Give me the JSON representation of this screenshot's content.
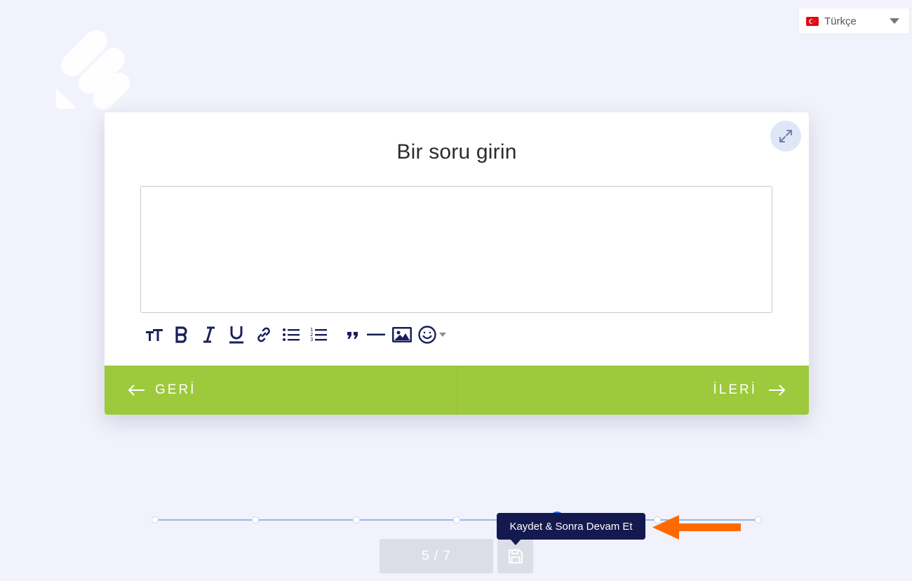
{
  "language": {
    "selected": "Türkçe"
  },
  "question": {
    "title": "Bir soru girin",
    "answer_value": ""
  },
  "toolbar": {
    "tools": [
      "text-size-icon",
      "bold-icon",
      "italic-icon",
      "underline-icon",
      "link-icon",
      "bullet-list-icon",
      "numbered-list-icon",
      "quote-icon",
      "horizontal-rule-icon",
      "image-icon",
      "emoji-icon"
    ]
  },
  "navigation": {
    "back_label": "GERİ",
    "next_label": "İLERİ"
  },
  "progress": {
    "current": 5,
    "total": 7,
    "label": "5 / 7"
  },
  "tooltip": {
    "text": "Kaydet & Sonra Devam Et"
  },
  "colors": {
    "nav_green": "#9dc93c",
    "tooltip_navy": "#141a4f",
    "slider_blue": "#1a73e8",
    "annotation_orange": "#ff6a00"
  }
}
